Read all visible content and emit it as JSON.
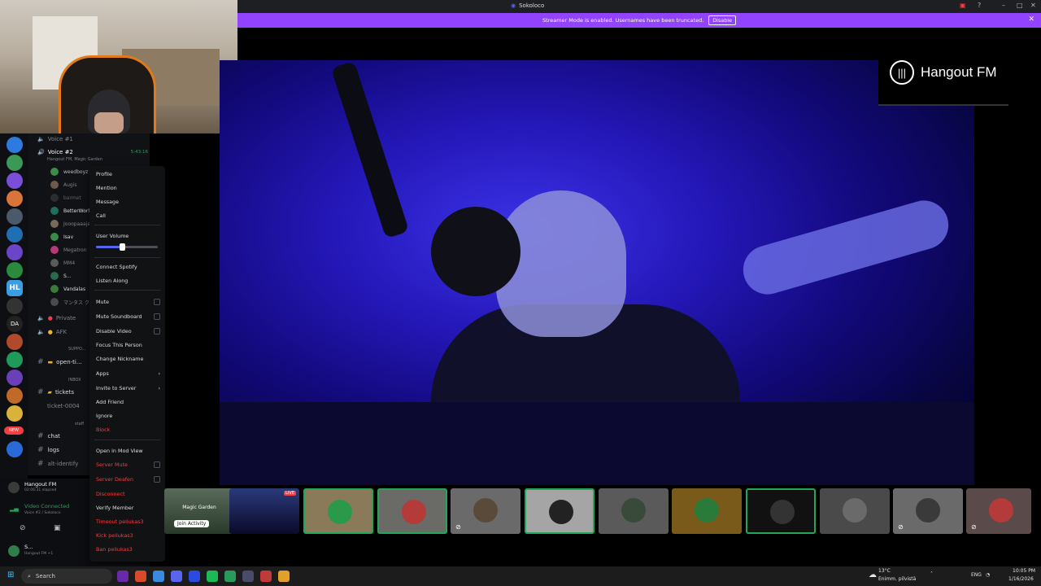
{
  "window": {
    "title": "Sokoloco"
  },
  "banner": {
    "text": "Streamer Mode is enabled. Usernames have been truncated.",
    "disable_label": "Disable"
  },
  "stage": {
    "logo_text": "Hangout FM"
  },
  "channels": {
    "voice1": "Voice #1",
    "voice2": "Voice #2",
    "voice2_time": "5:43:16",
    "voice2_sub": "Hangout FM, Magic Garden",
    "users": [
      "weedboyz",
      "Augis",
      "barmet",
      "BetterWorld",
      "Jooopaaaja",
      "Isav",
      "Megatron",
      "MM4",
      "S...",
      "Vandalas",
      "マンタス ク"
    ],
    "private": "Private",
    "afk": "AFK",
    "support_cat": "SUPPO...",
    "open_tickets": "open-ti...",
    "inbox_cat": "INBOX",
    "tickets": "tickets",
    "ticket_0004": "ticket-0004",
    "staff_cat": "staff",
    "chat": "chat",
    "logs": "logs",
    "alt_identify": "alt-identify"
  },
  "userpanel": {
    "server": "Hangout FM",
    "elapsed": "02:06:31 elapsed",
    "voice_connected": "Video Connected",
    "voice_sub": "Voice #2 / Sokoloco",
    "me_name": "S...",
    "me_sub": "Hangout FM +1"
  },
  "context_menu": {
    "profile": "Profile",
    "mention": "Mention",
    "message": "Message",
    "call": "Call",
    "user_volume": "User Volume",
    "user_volume_value": 0.42,
    "connect_spotify": "Connect Spotify",
    "listen_along": "Listen Along",
    "mute": "Mute",
    "mute_soundboard": "Mute Soundboard",
    "disable_video": "Disable Video",
    "focus_person": "Focus This Person",
    "change_nickname": "Change Nickname",
    "apps": "Apps",
    "invite_server": "Invite to Server",
    "add_friend": "Add Friend",
    "ignore": "Ignore",
    "block": "Block",
    "open_mod_view": "Open in Mod View",
    "server_mute": "Server Mute",
    "server_deafen": "Server Deafen",
    "disconnect": "Disconnect",
    "timeout": "Timeout peliukas3",
    "kick": "Kick peliukas3",
    "ban": "Ban peliukas3",
    "verify_member": "Verify Member"
  },
  "thumbs": {
    "first_label": "Magic Garden",
    "join_activity": "Join Activity",
    "live": "LIVE"
  },
  "taskbar": {
    "search": "Search",
    "weather_temp": "13°C",
    "weather_desc": "Enimm. pilvistä",
    "lang": "ENG",
    "time": "10:05 PM",
    "date": "1/16/2026"
  },
  "colors": {
    "accent": "#5865f2",
    "banner": "#9143ff",
    "danger": "#f23f43",
    "online": "#23a55a"
  }
}
